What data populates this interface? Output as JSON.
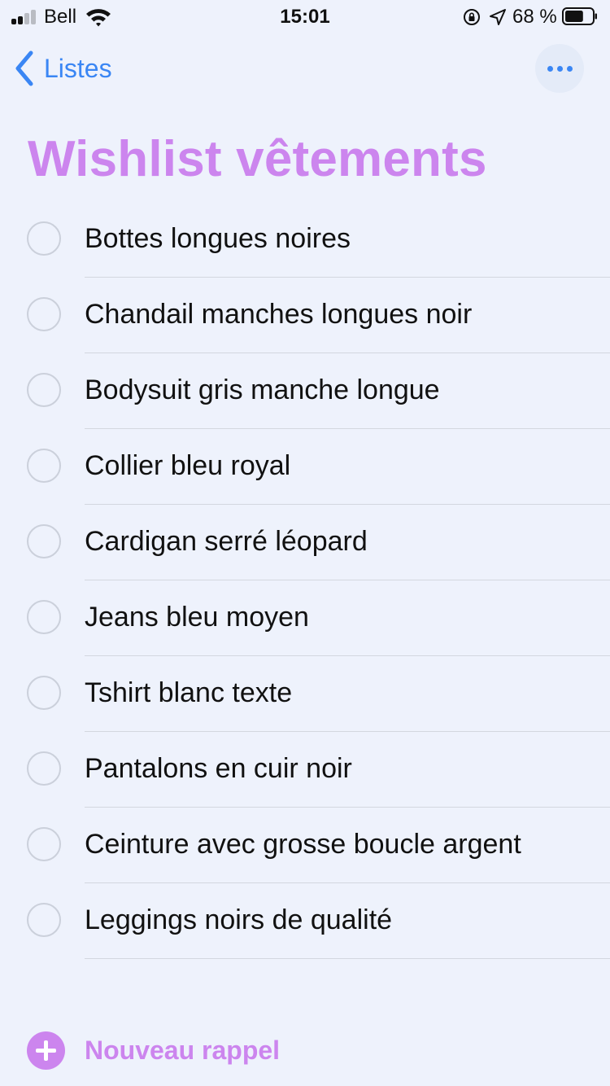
{
  "status_bar": {
    "carrier": "Bell",
    "time": "15:01",
    "battery_percent": "68 %",
    "battery_level": 0.68
  },
  "nav": {
    "back_label": "Listes"
  },
  "list": {
    "title": "Wishlist vêtements",
    "accent_color": "#cc85ee",
    "items": [
      {
        "label": "Bottes longues noires",
        "done": false
      },
      {
        "label": "Chandail manches longues noir",
        "done": false
      },
      {
        "label": "Bodysuit gris manche longue",
        "done": false
      },
      {
        "label": "Collier bleu royal",
        "done": false
      },
      {
        "label": "Cardigan serré léopard",
        "done": false
      },
      {
        "label": "Jeans bleu moyen",
        "done": false
      },
      {
        "label": "Tshirt blanc texte",
        "done": false
      },
      {
        "label": "Pantalons en cuir noir",
        "done": false
      },
      {
        "label": "Ceinture avec grosse boucle argent",
        "done": false
      },
      {
        "label": "Leggings noirs de qualité",
        "done": false
      }
    ]
  },
  "footer": {
    "new_reminder_label": "Nouveau rappel"
  }
}
